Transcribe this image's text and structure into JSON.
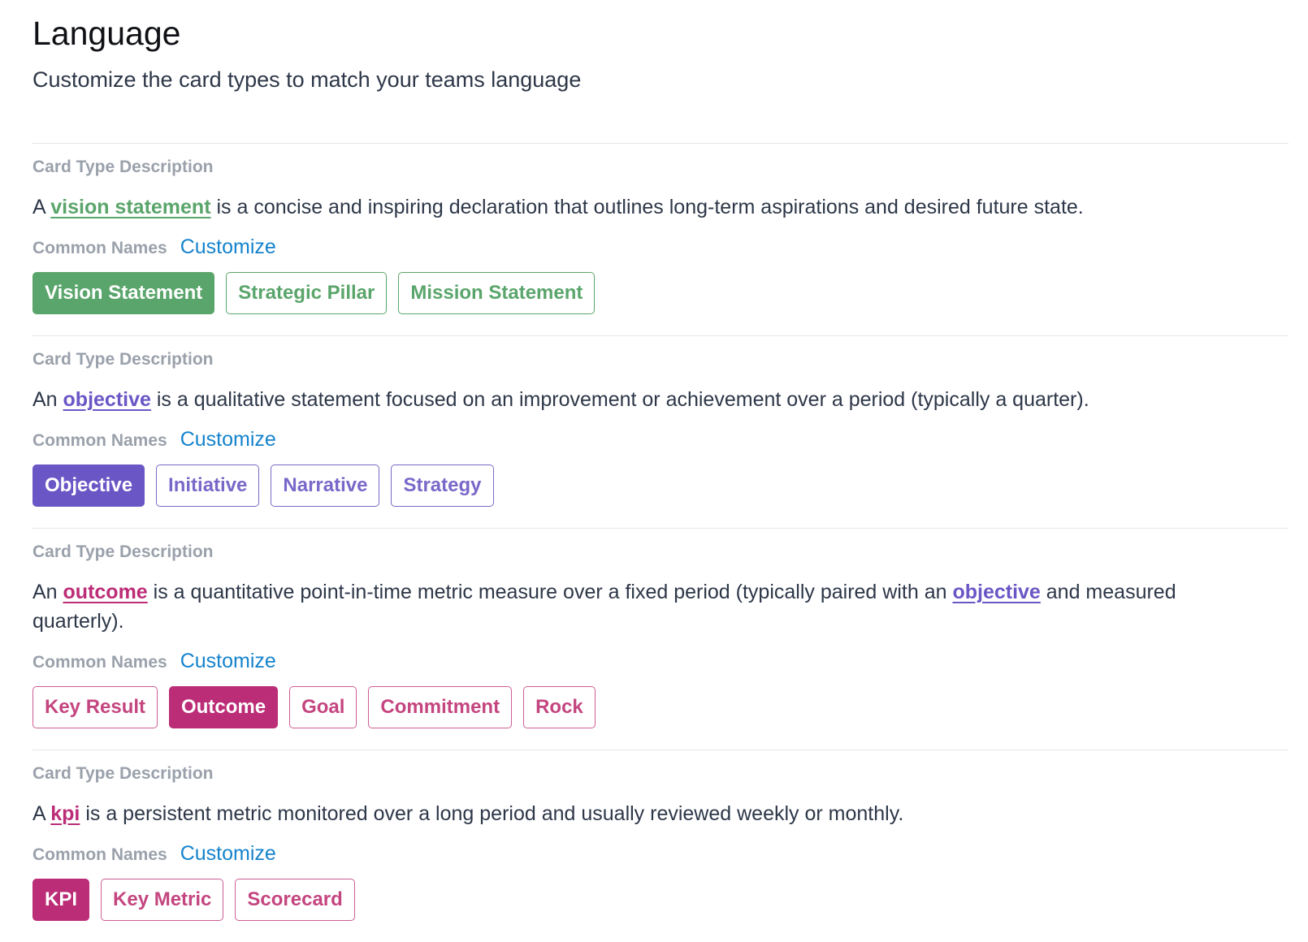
{
  "header": {
    "title": "Language",
    "subtitle": "Customize the card types to match your teams language"
  },
  "colors": {
    "green": "#5aa56b",
    "purple": "#6b56c6",
    "magenta": "#bc2d77",
    "link_blue": "#1583cc",
    "muted_label": "#9aa1ab"
  },
  "sections": [
    {
      "label": "Card Type Description",
      "description": {
        "pre": "A ",
        "term": "vision statement",
        "post": " is a concise and inspiring declaration that outlines long-term aspirations and desired future state."
      },
      "names_label": "Common Names",
      "customize": "Customize",
      "chips": [
        {
          "label": "Vision Statement",
          "selected": true
        },
        {
          "label": "Strategic Pillar",
          "selected": false
        },
        {
          "label": "Mission Statement",
          "selected": false
        }
      ]
    },
    {
      "label": "Card Type Description",
      "description": {
        "pre": "An ",
        "term": "objective",
        "post": " is a qualitative statement focused on an improvement or achievement over a period (typically a quarter)."
      },
      "names_label": "Common Names",
      "customize": "Customize",
      "chips": [
        {
          "label": "Objective",
          "selected": true
        },
        {
          "label": "Initiative",
          "selected": false
        },
        {
          "label": "Narrative",
          "selected": false
        },
        {
          "label": "Strategy",
          "selected": false
        }
      ]
    },
    {
      "label": "Card Type Description",
      "description": {
        "pre": "An ",
        "term": "outcome",
        "mid": " is a quantitative point-in-time metric measure over a fixed period (typically paired with an ",
        "term2": "objective",
        "post": " and measured quarterly)."
      },
      "names_label": "Common Names",
      "customize": "Customize",
      "chips": [
        {
          "label": "Key Result",
          "selected": false
        },
        {
          "label": "Outcome",
          "selected": true
        },
        {
          "label": "Goal",
          "selected": false
        },
        {
          "label": "Commitment",
          "selected": false
        },
        {
          "label": "Rock",
          "selected": false
        }
      ]
    },
    {
      "label": "Card Type Description",
      "description": {
        "pre": "A ",
        "term": "kpi",
        "post": " is a persistent metric monitored over a long period and usually reviewed weekly or monthly."
      },
      "names_label": "Common Names",
      "customize": "Customize",
      "chips": [
        {
          "label": "KPI",
          "selected": true
        },
        {
          "label": "Key Metric",
          "selected": false
        },
        {
          "label": "Scorecard",
          "selected": false
        }
      ]
    }
  ]
}
